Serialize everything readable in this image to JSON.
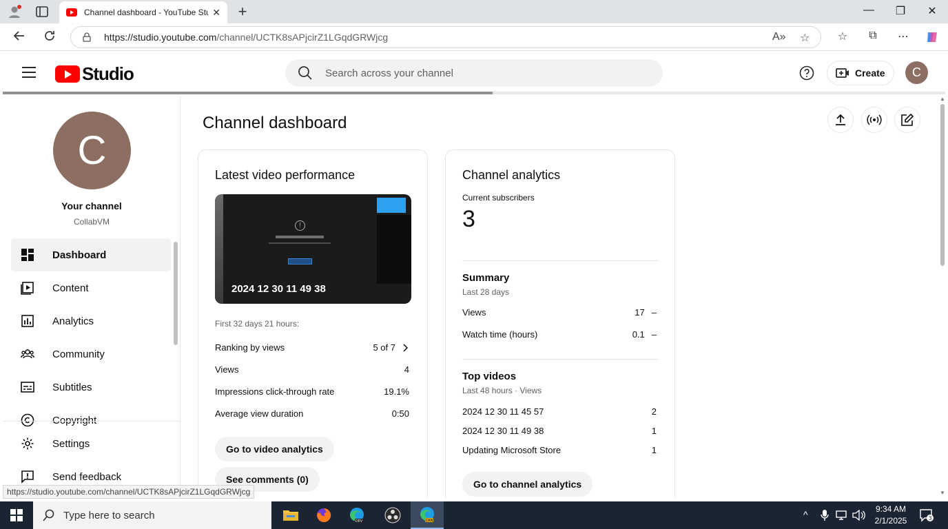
{
  "browser": {
    "tab_title": "Channel dashboard - YouTube Studio",
    "url_host": "https://studio.youtube.com",
    "url_path": "/channel/UCTK8sAPjcirZ1LGqdGRWjcg",
    "status_url": "https://studio.youtube.com/channel/UCTK8sAPjcirZ1LGqdGRWjcg"
  },
  "header": {
    "logo_text": "Studio",
    "search_placeholder": "Search across your channel",
    "create_label": "Create",
    "avatar_letter": "C",
    "loading_progress": 0.52
  },
  "sidebar": {
    "avatar_letter": "C",
    "your_channel": "Your channel",
    "channel_name": "CollabVM",
    "items": [
      {
        "label": "Dashboard",
        "icon": "dashboard-icon",
        "active": true
      },
      {
        "label": "Content",
        "icon": "content-icon"
      },
      {
        "label": "Analytics",
        "icon": "analytics-icon"
      },
      {
        "label": "Community",
        "icon": "community-icon"
      },
      {
        "label": "Subtitles",
        "icon": "subtitles-icon"
      },
      {
        "label": "Copyright",
        "icon": "copyright-icon"
      }
    ],
    "bottom": [
      {
        "label": "Settings",
        "icon": "gear-icon"
      },
      {
        "label": "Send feedback",
        "icon": "feedback-icon"
      }
    ]
  },
  "main": {
    "title": "Channel dashboard",
    "latest": {
      "title": "Latest video performance",
      "video_title": "2024 12 30 11 49 38",
      "period": "First 32 days 21 hours:",
      "rows": [
        {
          "label": "Ranking by views",
          "value": "5 of 7"
        },
        {
          "label": "Views",
          "value": "4"
        },
        {
          "label": "Impressions click-through rate",
          "value": "19.1%"
        },
        {
          "label": "Average view duration",
          "value": "0:50"
        }
      ],
      "btn_analytics": "Go to video analytics",
      "btn_comments": "See comments (0)"
    },
    "analytics": {
      "title": "Channel analytics",
      "subs_label": "Current subscribers",
      "subs_value": "3",
      "summary_title": "Summary",
      "summary_period": "Last 28 days",
      "summary_rows": [
        {
          "label": "Views",
          "value": "17",
          "trend": "–"
        },
        {
          "label": "Watch time (hours)",
          "value": "0.1",
          "trend": "–"
        }
      ],
      "top_title": "Top videos",
      "top_period": "Last 48 hours · Views",
      "top_rows": [
        {
          "label": "2024 12 30 11 45 57",
          "value": "2"
        },
        {
          "label": "2024 12 30 11 49 38",
          "value": "1"
        },
        {
          "label": "Updating Microsoft Store",
          "value": "1"
        }
      ],
      "btn_channel": "Go to channel analytics"
    }
  },
  "taskbar": {
    "search_placeholder": "Type here to search",
    "time": "9:34 AM",
    "date": "2/1/2025",
    "notif_count": "3"
  },
  "colors": {
    "youtube_red": "#ff0000",
    "avatar_brown": "#8c6e63",
    "taskbar": "#1a2432"
  }
}
